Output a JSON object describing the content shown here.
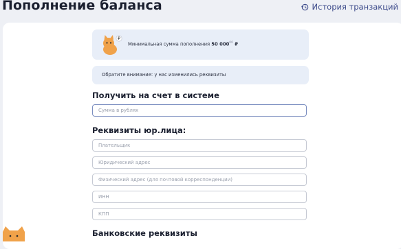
{
  "header": {
    "title": "Пополнение баланса",
    "history_label": "История транзакций"
  },
  "info": {
    "text_prefix": "Минимальная сумма пополнения",
    "amount": "50 000",
    "amount_sup": "00",
    "currency": "₽"
  },
  "notice": {
    "text": "Обратите внимание: у нас изменились реквизиты"
  },
  "receive": {
    "title": "Получить на счет в системе",
    "amount_placeholder": "Сумма в рублях"
  },
  "legal": {
    "title": "Реквизиты юр.лица:",
    "payer_placeholder": "Плательщик",
    "legal_address_placeholder": "Юридический адрес",
    "physical_address_placeholder": "Физический адрес (для почтовой корреспонденции)",
    "inn_placeholder": "ИНН",
    "kpp_placeholder": "КПП"
  },
  "bank": {
    "title": "Банковские реквизиты"
  },
  "colors": {
    "accent": "#3c4a8a",
    "card_bg": "#e8eef8",
    "mascot_orange": "#f0a24a"
  }
}
